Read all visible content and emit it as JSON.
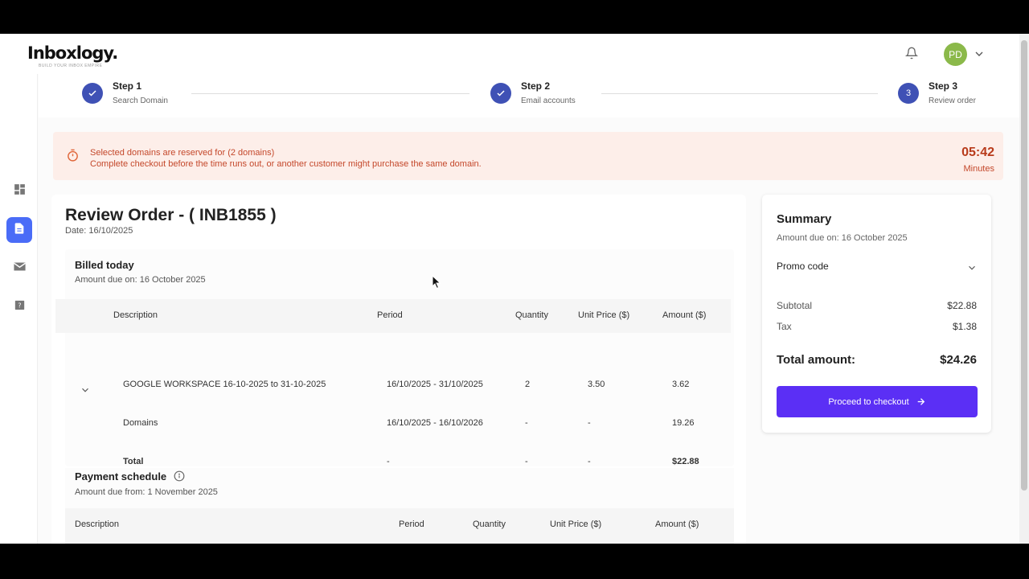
{
  "brand": {
    "logo": "Inboxlogy.",
    "tagline": "BUILD YOUR INBOX EMPIRE"
  },
  "header": {
    "avatar_initials": "PD"
  },
  "colors": {
    "accent": "#5b2ff5",
    "step": "#3f51b5",
    "alert_text": "#c4482b",
    "alert_bg": "#fdeee9",
    "avatar": "#8bb94a"
  },
  "sidebar": {
    "items": [
      {
        "icon": "dashboard-icon"
      },
      {
        "icon": "document-icon",
        "active": true
      },
      {
        "icon": "mail-icon"
      },
      {
        "icon": "help-book-icon"
      }
    ]
  },
  "stepper": {
    "steps": [
      {
        "title": "Step 1",
        "subtitle": "Search Domain",
        "status": "done"
      },
      {
        "title": "Step 2",
        "subtitle": "Email accounts",
        "status": "done"
      },
      {
        "title": "Step 3",
        "subtitle": "Review order",
        "status": "current",
        "number": "3"
      }
    ]
  },
  "alert": {
    "line1": "Selected domains are reserved for (2 domains)",
    "line2": "Complete checkout before the time runs out, or another customer might purchase the same domain.",
    "timer": "05:42",
    "timer_unit": "Minutes"
  },
  "order": {
    "title": "Review Order - ( INB1855 )",
    "date": "Date: 16/10/2025",
    "billed": {
      "title": "Billed today",
      "subtitle": "Amount due on: 16 October 2025",
      "columns": [
        "Description",
        "Period",
        "Quantity",
        "Unit Price ($)",
        "Amount ($)"
      ],
      "rows": [
        {
          "description": "GOOGLE WORKSPACE 16-10-2025 to 31-10-2025",
          "period": "16/10/2025 - 31/10/2025",
          "quantity": "2",
          "unit_price": "3.50",
          "amount": "3.62"
        },
        {
          "description": "Domains",
          "period": "16/10/2025 - 16/10/2026",
          "quantity": "-",
          "unit_price": "-",
          "amount": "19.26"
        },
        {
          "description": "Total",
          "period": "-",
          "quantity": "-",
          "unit_price": "-",
          "amount": "$22.88"
        }
      ]
    },
    "schedule": {
      "title": "Payment schedule",
      "subtitle": "Amount due from: 1 November 2025",
      "columns": [
        "Description",
        "Period",
        "Quantity",
        "Unit Price ($)",
        "Amount ($)"
      ]
    }
  },
  "summary": {
    "title": "Summary",
    "subtitle": "Amount due on: 16 October 2025",
    "promo_label": "Promo code",
    "subtotal_label": "Subtotal",
    "subtotal_value": "$22.88",
    "tax_label": "Tax",
    "tax_value": "$1.38",
    "total_label": "Total amount:",
    "total_value": "$24.26",
    "checkout_label": "Proceed to checkout"
  }
}
